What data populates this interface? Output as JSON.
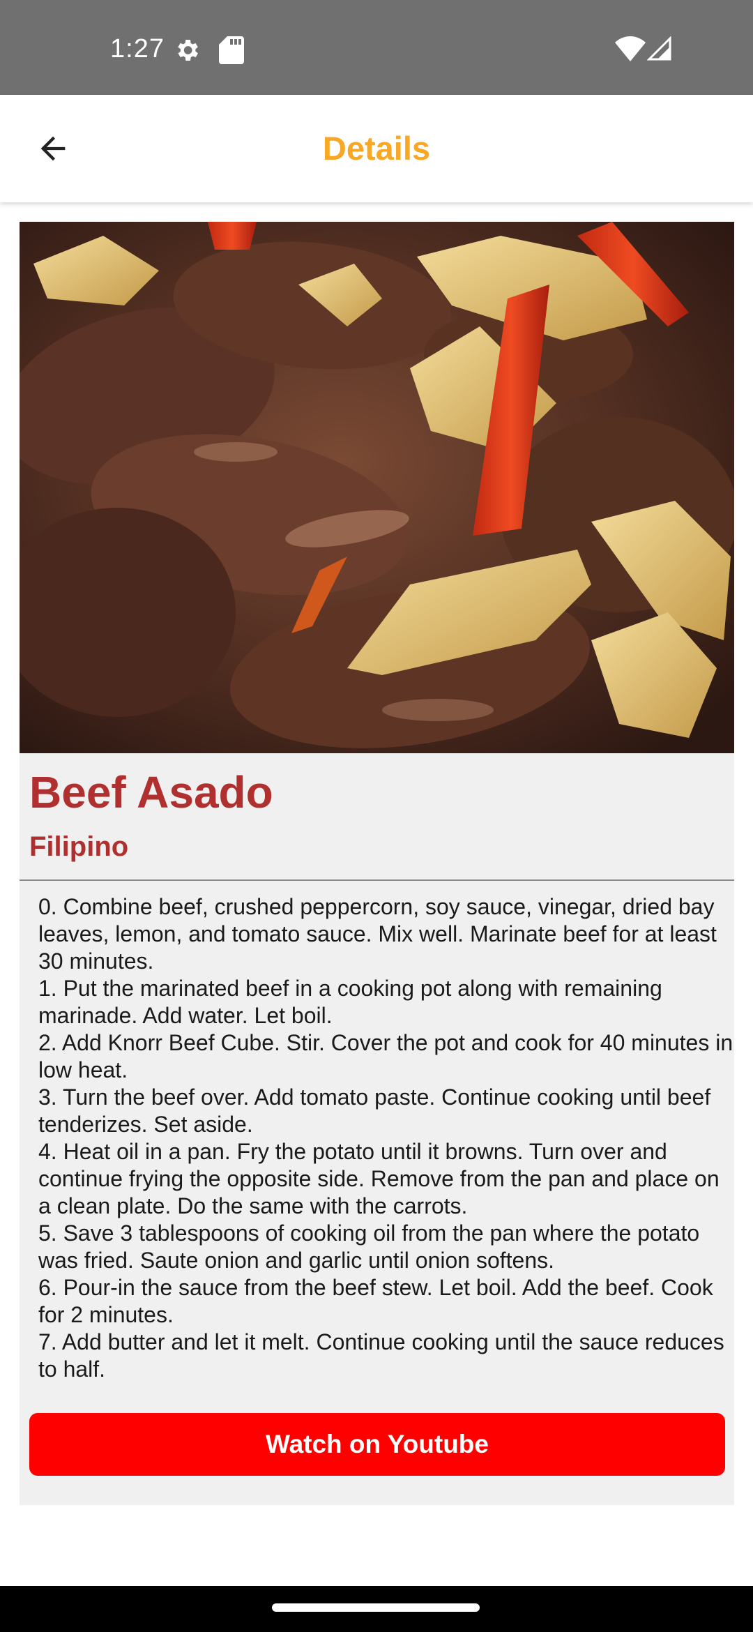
{
  "status_bar": {
    "time": "1:27",
    "icons": [
      "gear-icon",
      "sd-card-icon",
      "wifi-icon",
      "cellular-signal-icon"
    ]
  },
  "app_bar": {
    "title": "Details",
    "title_color": "#f9a825",
    "back_icon": "arrow-left-icon"
  },
  "meal": {
    "image_description": "Beef asado stew with potatoes and red bell pepper",
    "name": "Beef Asado",
    "area": "Filipino",
    "accent_color": "#b03030",
    "instructions": [
      "0. Combine beef, crushed peppercorn, soy sauce, vinegar, dried bay leaves, lemon, and tomato sauce. Mix well. Marinate beef for at least 30 minutes.",
      "1. Put the marinated beef in a cooking pot along with remaining marinade. Add water. Let boil.",
      "2. Add Knorr Beef Cube. Stir. Cover the pot and cook for 40 minutes in low heat.",
      "3. Turn the beef over. Add tomato paste. Continue cooking until beef tenderizes. Set aside.",
      "4. Heat oil in a pan. Fry the potato until it browns. Turn over and continue frying the opposite side. Remove from the pan and place on a clean plate. Do the same with the carrots.",
      "5. Save 3 tablespoons of cooking oil from the pan where the potato was fried. Saute onion and garlic until onion softens.",
      "6. Pour-in the sauce from the beef stew. Let boil. Add the beef. Cook for 2 minutes.",
      "7. Add butter and let it melt. Continue cooking until the sauce reduces to half."
    ]
  },
  "youtube_button": {
    "label": "Watch on Youtube",
    "color": "#fe0000"
  }
}
